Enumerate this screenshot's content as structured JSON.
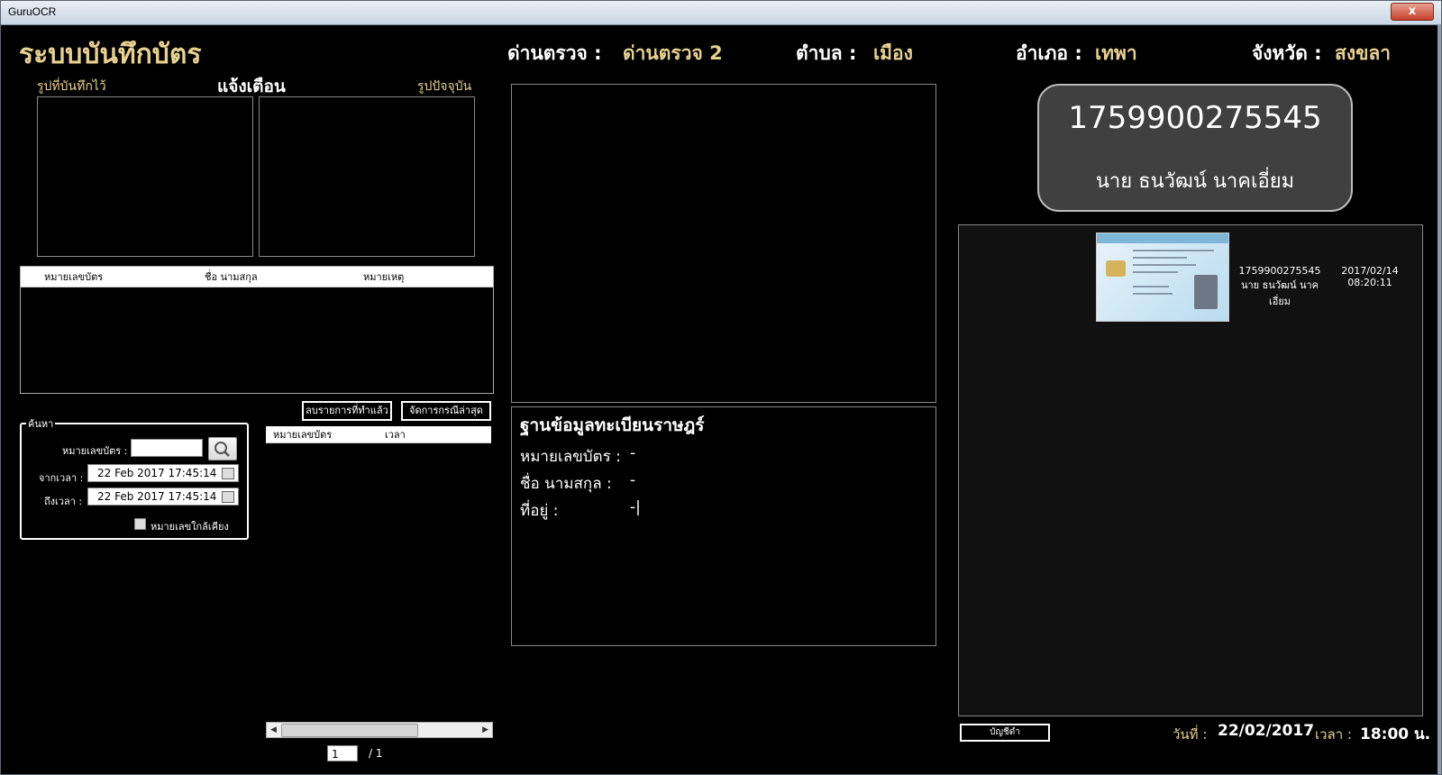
{
  "window": {
    "title": "GuruOCR",
    "close_label": "x"
  },
  "header": {
    "app_title": "ระบบบันทึกบัตร",
    "checkpoint_label": "ด่านตรวจ :",
    "checkpoint_value": "ด่านตรวจ 2",
    "subdistrict_label": "ตำบล :",
    "subdistrict_value": "เมือง",
    "district_label": "อำเภอ :",
    "district_value": "เทพา",
    "province_label": "จังหวัด :",
    "province_value": "สงขลา"
  },
  "alert": {
    "saved_photo_label": "รูปที่บันทึกไว้",
    "title": "แจ้งเตือน",
    "current_photo_label": "รูปปัจจุบัน"
  },
  "alert_table": {
    "columns": [
      "หมายเลขบัตร",
      "ชื่อ นามสกุล",
      "หมายเหตุ"
    ]
  },
  "buttons": {
    "delete_done": "ลบรายการที่ทำแล้ว",
    "manage_latest": "จัดการกรณีล่าสุด",
    "account": "บัญชีดำ"
  },
  "search": {
    "legend": "ค้นหา",
    "card_number_label": "หมายเลขบัตร :",
    "card_number_value": "",
    "from_label": "จากเวลา :",
    "from_value": "22 Feb 2017   17:45:14",
    "to_label": "ถึงเวลา :",
    "to_value": "22 Feb 2017   17:45:14",
    "similar_label": "หมายเลขใกล้เคียง"
  },
  "results_table": {
    "columns": [
      "หมายเลขบัตร",
      "เวลา"
    ]
  },
  "pager": {
    "current": "1",
    "total": "/ 1"
  },
  "registry": {
    "title": "ฐานข้อมูลทะเบียนราษฎร์",
    "card_label": "หมายเลขบัตร :",
    "card_value": "-",
    "name_label": "ชื่อ นามสกุล :",
    "name_value": "-",
    "address_label": "ที่อยู่ :",
    "address_value": "-|"
  },
  "id_card": {
    "number": "1759900275545",
    "name": "นาย ธนวัฒน์ นาคเอี่ยม"
  },
  "result": {
    "number": "1759900275545",
    "name": "นาย ธนวัฒน์ นาคเอี่ยม",
    "date": "2017/02/14",
    "time": "08:20:11"
  },
  "footer": {
    "date_label": "วันที่ :",
    "date_value": "22/02/2017",
    "time_label": "เวลา :",
    "time_value": "18:00 น."
  }
}
